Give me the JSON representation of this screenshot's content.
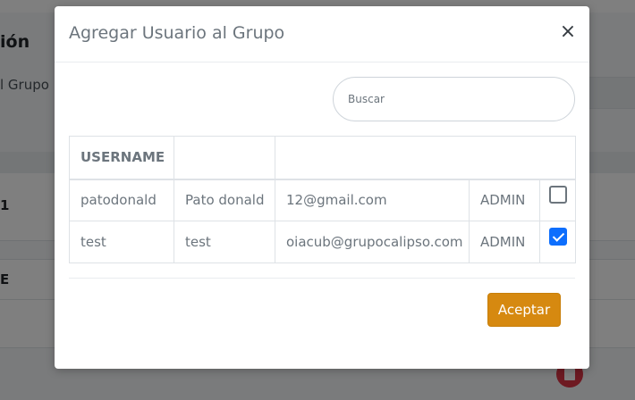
{
  "background": {
    "page_title_fragment": "ión",
    "subtitle_fragment": "l Grupo",
    "row1_fragment": "1",
    "row2_fragment": "E"
  },
  "modal": {
    "title": "Agregar Usuario al Grupo",
    "close_glyph": "×",
    "search": {
      "placeholder": "Buscar",
      "value": ""
    },
    "table": {
      "headers": [
        "USERNAME",
        "",
        ""
      ],
      "rows": [
        {
          "username": "patodonald",
          "name": "Pato donald",
          "email": "12@gmail.com",
          "role": "ADMIN",
          "selected": false
        },
        {
          "username": "test",
          "name": "test",
          "email": "oiacub@grupocalipso.com",
          "role": "ADMIN",
          "selected": true
        }
      ]
    },
    "accept_label": "Aceptar"
  },
  "colors": {
    "accent_button": "#d68910",
    "checkbox_checked": "#0d6efd",
    "delete_button": "#dc3545"
  }
}
